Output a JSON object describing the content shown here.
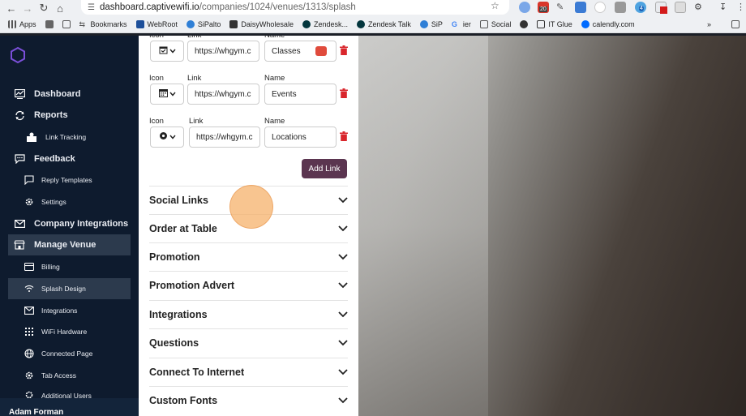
{
  "browser": {
    "url_host": "dashboard.captivewifi.io",
    "url_path": "/companies/1024/venues/1313/splash",
    "bookmarks": [
      "Apps",
      "Bookmarks",
      "WebRoot",
      "SiPalto",
      "DaisyWholesale",
      "Zendesk...",
      "Zendesk Talk",
      "SiP",
      "ier",
      "Social",
      "IT Glue",
      "calendly.com"
    ],
    "badges": [
      "20",
      "4"
    ]
  },
  "sidebar": {
    "items": [
      {
        "label": "Dashboard",
        "icon": "dashboard-icon"
      },
      {
        "label": "Reports",
        "icon": "reports-icon"
      },
      {
        "label": "Link Tracking",
        "icon": "link-tracking-icon"
      },
      {
        "label": "Feedback",
        "icon": "feedback-icon"
      },
      {
        "label": "Reply Templates",
        "icon": "reply-templates-icon"
      },
      {
        "label": "Settings",
        "icon": "settings-icon"
      },
      {
        "label": "Company Integrations",
        "icon": "mail-icon"
      },
      {
        "label": "Manage Venue",
        "icon": "venue-icon"
      },
      {
        "label": "Billing",
        "icon": "billing-icon"
      },
      {
        "label": "Splash Design",
        "icon": "wifi-icon"
      },
      {
        "label": "Integrations",
        "icon": "integrations-icon"
      },
      {
        "label": "WiFi Hardware",
        "icon": "hardware-icon"
      },
      {
        "label": "Connected Page",
        "icon": "globe-icon"
      },
      {
        "label": "Tab Access",
        "icon": "tab-access-icon"
      },
      {
        "label": "Additional Users",
        "icon": "users-icon"
      }
    ],
    "user_name": "Adam Forman"
  },
  "links": {
    "icon_label": "Icon",
    "link_label": "Link",
    "name_label": "Name",
    "rows": [
      {
        "icon": "calendar-check-icon",
        "link": "https://whgym.c",
        "name": "Classes"
      },
      {
        "icon": "calendar-icon",
        "link": "https://whgym.c",
        "name": "Events"
      },
      {
        "icon": "location-dot-icon",
        "link": "https://whgym.c",
        "name": "Locations"
      }
    ],
    "add_label": "Add Link"
  },
  "sections": [
    "Social Links",
    "Order at Table",
    "Promotion",
    "Promotion Advert",
    "Integrations",
    "Questions",
    "Connect To Internet",
    "Custom Fonts"
  ],
  "colors": {
    "sidebar_bg": "#0e1b2e",
    "active_item": "#2c3a4d",
    "button_bg": "#5b3550",
    "trash": "#d9262c",
    "click_indicator": "#f6b26b"
  }
}
